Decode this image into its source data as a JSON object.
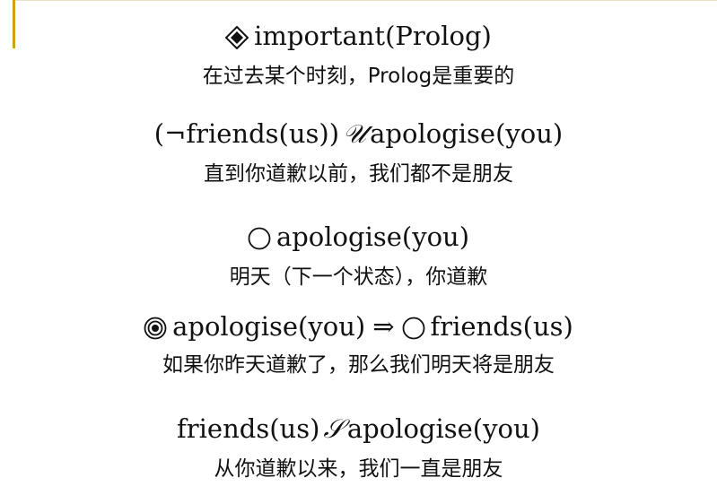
{
  "items": [
    {
      "formula_left": "",
      "formula_op": "",
      "formula_right": "important(Prolog)",
      "operator_icon": "diamond-minus-icon",
      "caption": "在过去某个时刻，Prolog是重要的"
    },
    {
      "formula_left": "(¬friends(us))",
      "formula_op": "𝒰",
      "formula_right": "apologise(you)",
      "operator_icon": "",
      "caption": "直到你道歉以前，我们都不是朋友"
    },
    {
      "formula_left": "",
      "formula_op": "",
      "formula_right": "apologise(you)",
      "operator_icon": "circle-icon",
      "caption": "明天（下一个状态），你道歉"
    },
    {
      "formula_left": "apologise(you)",
      "formula_op": "⇒",
      "formula_right": "friends(us)",
      "operator_icon": "double-circle-icon",
      "operator_icon_2": "circle-icon",
      "caption": "如果你昨天道歉了，那么我们明天将是朋友"
    },
    {
      "formula_left": "friends(us)",
      "formula_op": "𝒮",
      "formula_right": "apologise(you)",
      "operator_icon": "",
      "caption": "从你道歉以来，我们一直是朋友"
    }
  ],
  "colors": {
    "text": "#111111",
    "accent": "#d4a017",
    "background": "#ffffff"
  }
}
